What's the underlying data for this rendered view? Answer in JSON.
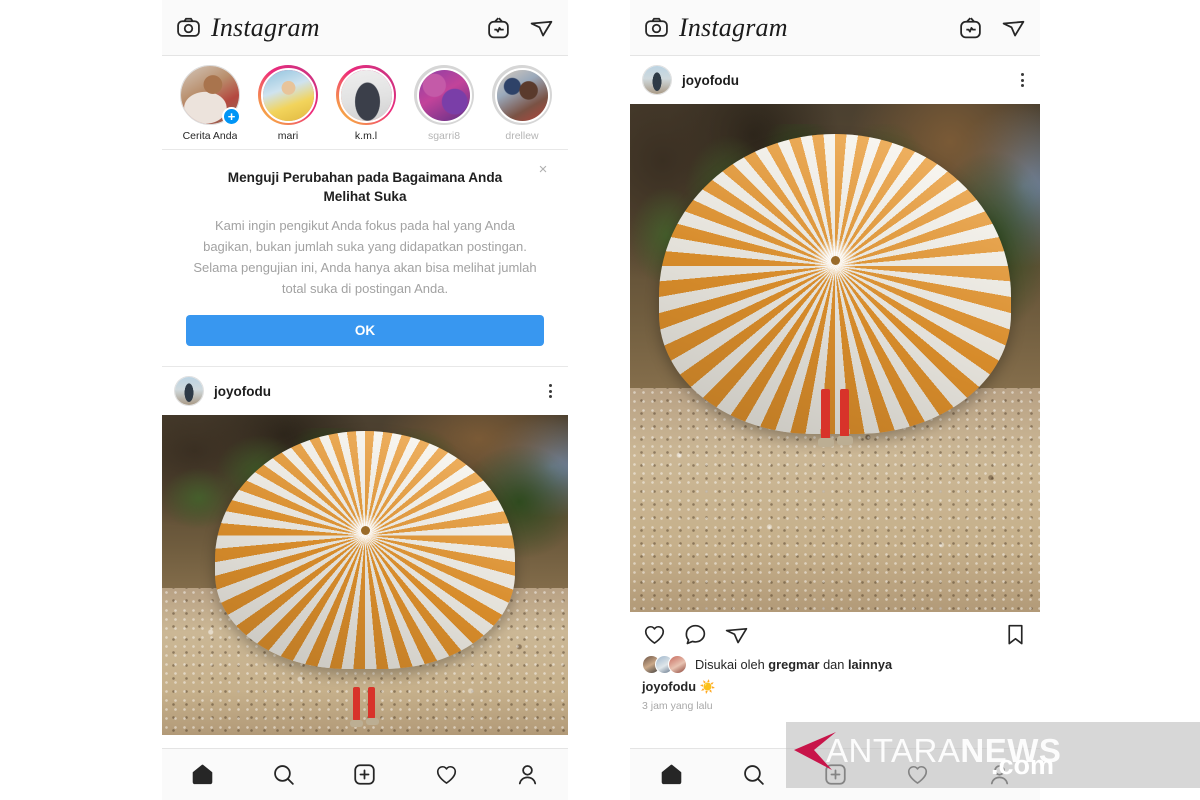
{
  "app": {
    "name": "Instagram",
    "header": {
      "camera_icon": "camera-icon",
      "igtv_icon": "igtv-icon",
      "send_icon": "send-icon"
    }
  },
  "stories": {
    "items": [
      {
        "label": "Cerita Anda",
        "ring": "none",
        "has_add_badge": true,
        "add_badge": "+"
      },
      {
        "label": "mari",
        "ring": "unseen",
        "has_add_badge": false
      },
      {
        "label": "k.m.l",
        "ring": "unseen",
        "has_add_badge": false
      },
      {
        "label": "sgarri8",
        "ring": "seen",
        "has_add_badge": false
      },
      {
        "label": "drellew",
        "ring": "seen",
        "has_add_badge": false
      }
    ]
  },
  "notice": {
    "title": "Menguji Perubahan pada Bagaimana Anda Melihat Suka",
    "body": "Kami ingin pengikut Anda fokus pada hal yang Anda bagikan, bukan jumlah suka yang didapatkan postingan. Selama pengujian ini, Anda hanya akan bisa melihat jumlah total suka di postingan Anda.",
    "ok_label": "OK",
    "close_label": "×",
    "ok_color": "#3897f0"
  },
  "post_left": {
    "username": "joyofodu",
    "menu_icon": "more-options-icon",
    "photo_alt": "orange-white-striped-beach-umbrella"
  },
  "post_right": {
    "username": "joyofodu",
    "menu_icon": "more-options-icon",
    "photo_alt": "orange-white-striped-beach-umbrella",
    "actions": {
      "like_icon": "heart-icon",
      "comment_icon": "comment-icon",
      "share_icon": "send-icon",
      "save_icon": "bookmark-icon"
    },
    "likes_prefix": "Disukai oleh",
    "likes_user": "gregmar",
    "likes_middle": "dan",
    "likes_suffix": "lainnya",
    "caption_user": "joyofodu",
    "caption_emoji": "☀️",
    "timestamp": "3 jam yang lalu"
  },
  "bottom_nav": {
    "items": [
      {
        "name": "home",
        "icon": "home-icon",
        "active": true
      },
      {
        "name": "search",
        "icon": "search-icon",
        "active": false
      },
      {
        "name": "add",
        "icon": "plus-square-icon",
        "active": false
      },
      {
        "name": "activity",
        "icon": "heart-icon",
        "active": false
      },
      {
        "name": "profile",
        "icon": "person-icon",
        "active": false
      }
    ]
  },
  "watermark": {
    "text_light": "ANTARA",
    "text_bold": "NEWS",
    "dotcom": ".com",
    "logo_icon": "antara-arrow-logo",
    "logo_color": "#c8154a"
  }
}
